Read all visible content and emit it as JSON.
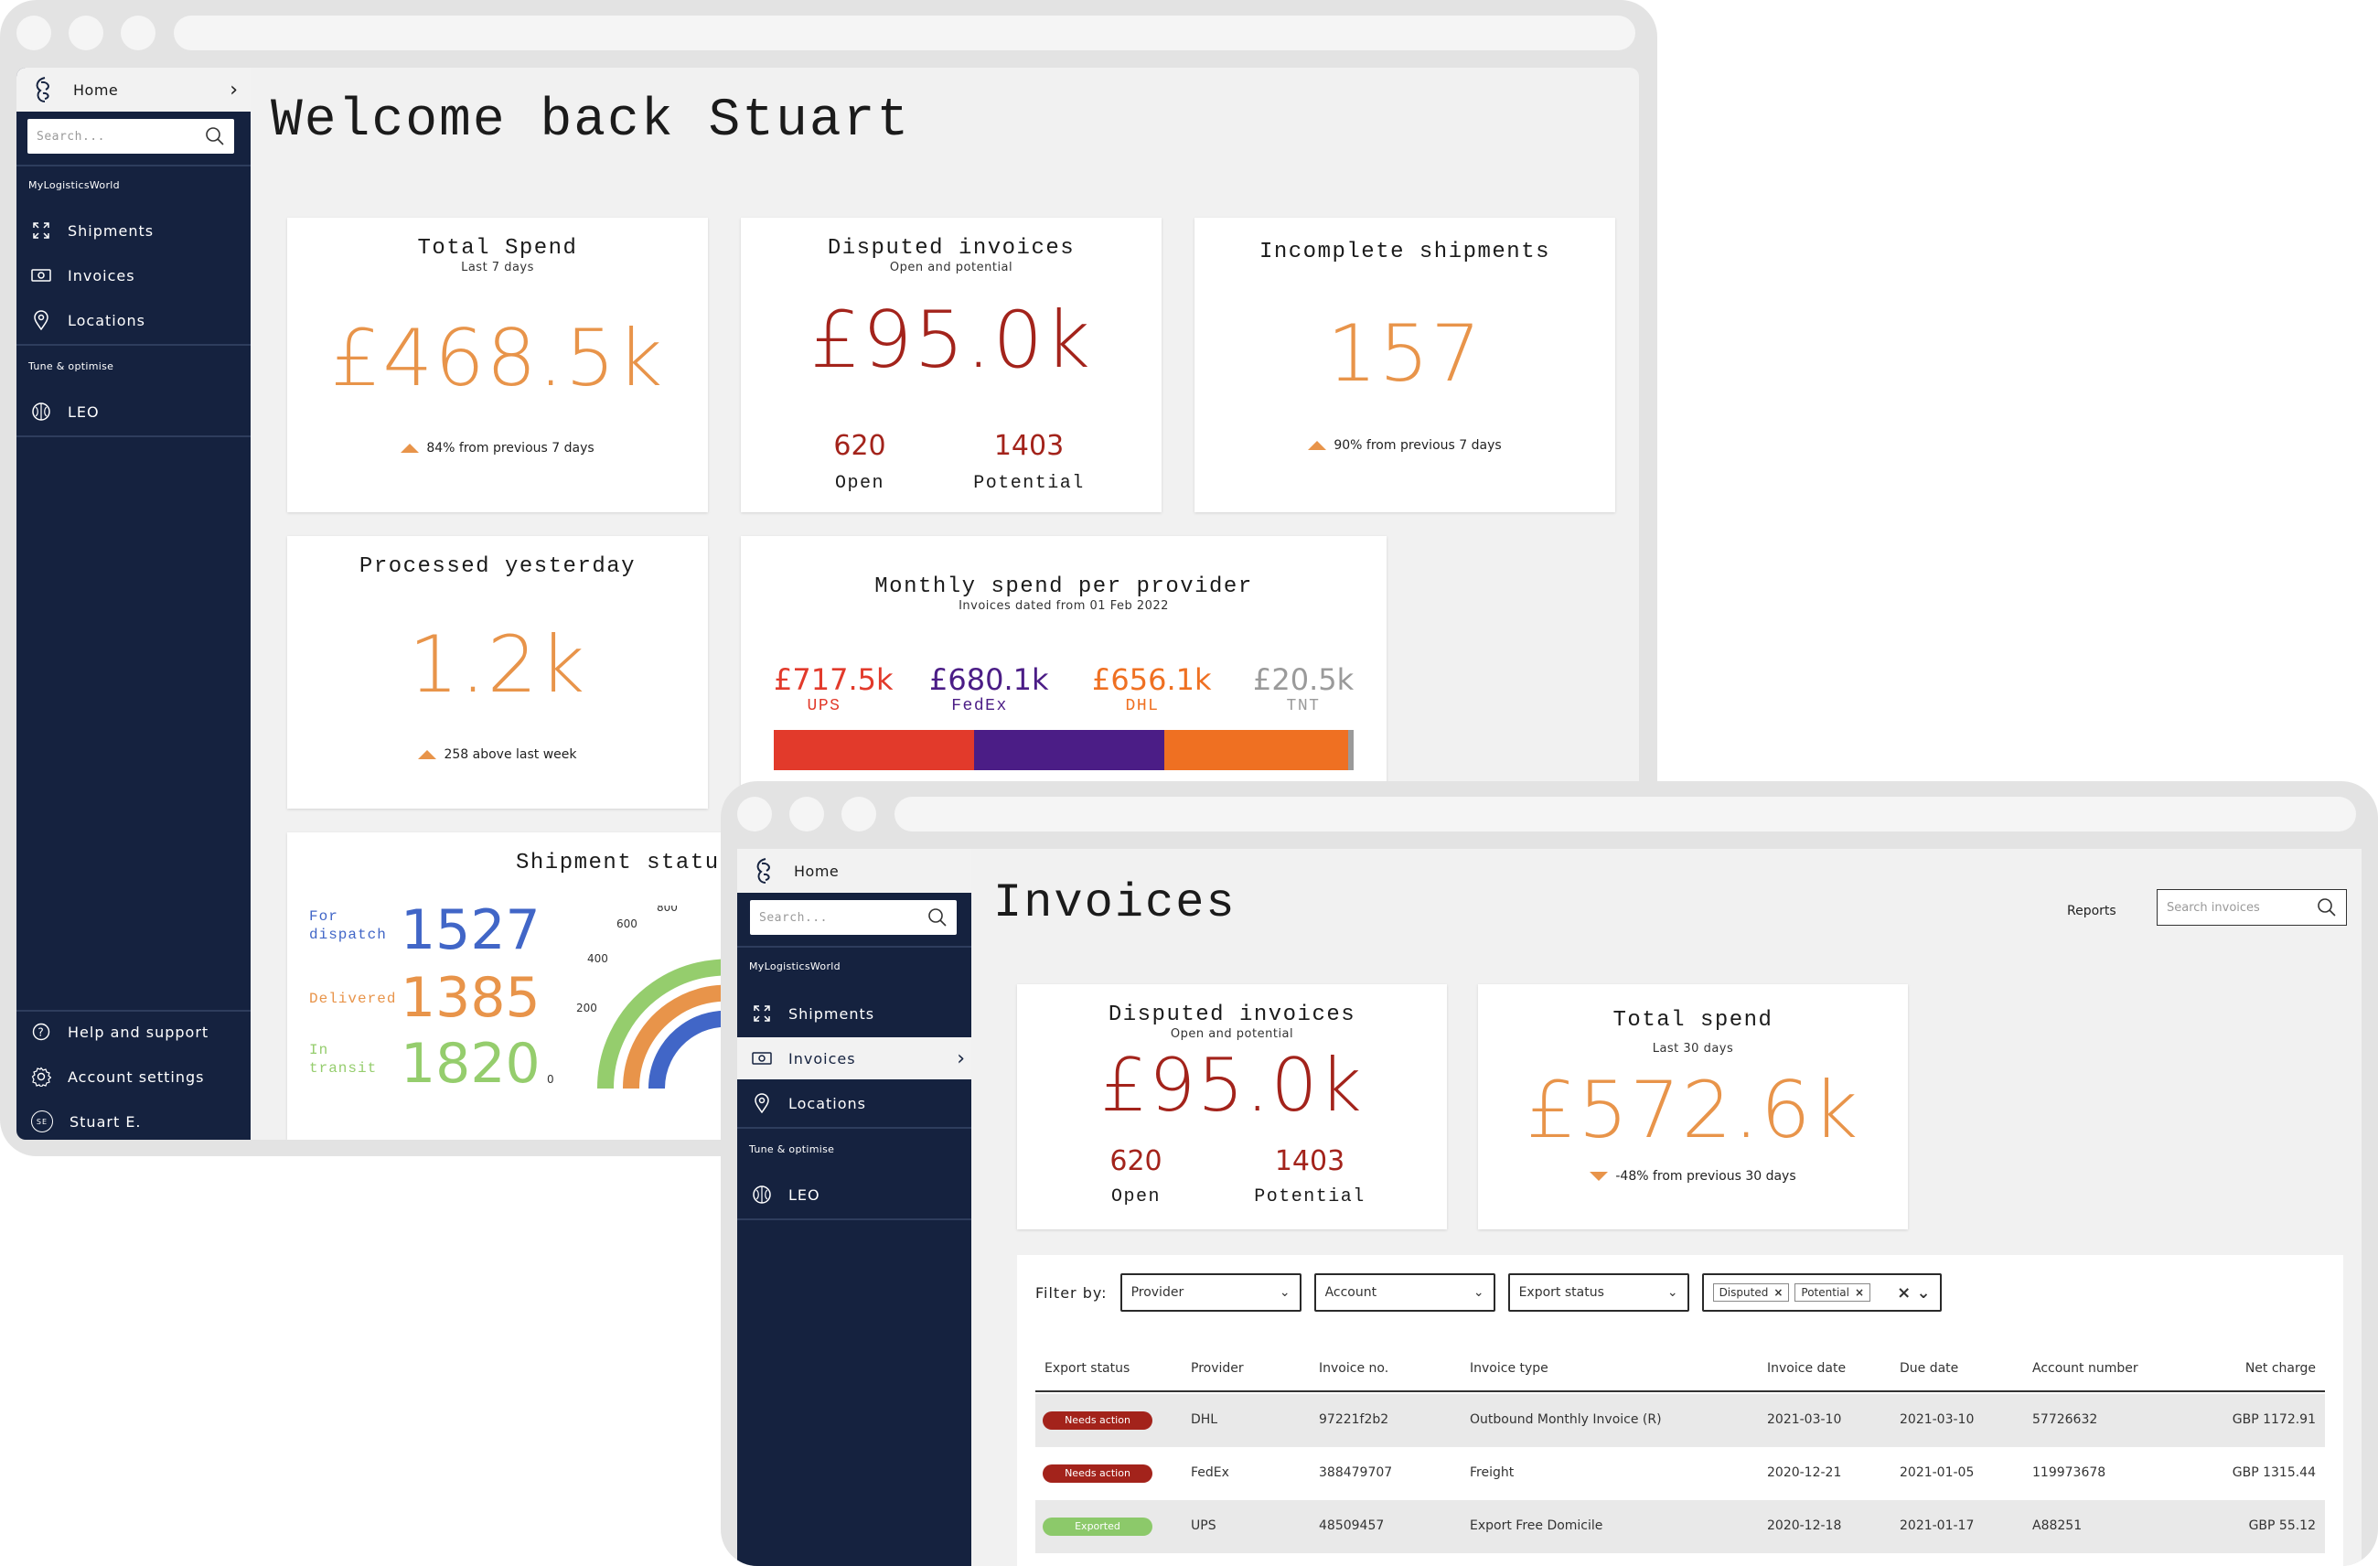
{
  "back_window": {
    "sidebar": {
      "home_label": "Home",
      "search_placeholder": "Search...",
      "section_main": "MyLogisticsWorld",
      "items": [
        {
          "label": "Shipments",
          "icon": "expand-arrows-icon"
        },
        {
          "label": "Invoices",
          "icon": "invoice-icon"
        },
        {
          "label": "Locations",
          "icon": "location-pin-icon"
        }
      ],
      "section_tune": "Tune & optimise",
      "leo_label": "LEO",
      "bottom_items": [
        {
          "label": "Help and support",
          "icon": "help-icon"
        },
        {
          "label": "Account settings",
          "icon": "gear-icon"
        },
        {
          "label": "Stuart E.",
          "icon": "avatar",
          "initials": "SE"
        }
      ]
    },
    "welcome": "Welcome back Stuart",
    "total_spend": {
      "title": "Total Spend",
      "subtitle": "Last 7 days",
      "value": "£468.5k",
      "delta": "84% from previous 7 days"
    },
    "disputed": {
      "title": "Disputed invoices",
      "subtitle": "Open and potential",
      "value": "£95.0k",
      "open_count": "620",
      "open_label": "Open",
      "potential_count": "1403",
      "potential_label": "Potential"
    },
    "incomplete": {
      "title": "Incomplete shipments",
      "value": "157",
      "delta": "90% from previous 7 days"
    },
    "processed": {
      "title": "Processed yesterday",
      "value": "1.2k",
      "delta": "258 above last week"
    },
    "monthly": {
      "title": "Monthly spend per provider",
      "subtitle": "Invoices dated from 01 Feb 2022",
      "providers": [
        {
          "value": "£717.5k",
          "name": "UPS",
          "color": "#e23a2b",
          "amount": 717.5
        },
        {
          "value": "£680.1k",
          "name": "FedEx",
          "color": "#4b1d86",
          "amount": 680.1
        },
        {
          "value": "£656.1k",
          "name": "DHL",
          "color": "#ef7022",
          "amount": 656.1
        },
        {
          "value": "£20.5k",
          "name": "TNT",
          "color": "#9a9a9a",
          "amount": 20.5
        }
      ]
    },
    "shipment_status": {
      "title": "Shipment status",
      "rows": [
        {
          "label": "For dispatch",
          "value": "1527",
          "color": "#4166c7"
        },
        {
          "label": "Delivered",
          "value": "1385",
          "color": "#e8944a"
        },
        {
          "label": "In transit",
          "value": "1820",
          "color": "#95cd6d"
        }
      ],
      "gauge_ticks": [
        "0",
        "200",
        "400",
        "600",
        "800"
      ]
    }
  },
  "front_window": {
    "sidebar": {
      "home_label": "Home",
      "search_placeholder": "Search...",
      "section_main": "MyLogisticsWorld",
      "items": [
        {
          "label": "Shipments",
          "icon": "expand-arrows-icon"
        },
        {
          "label": "Invoices",
          "icon": "invoice-icon",
          "active": true
        },
        {
          "label": "Locations",
          "icon": "location-pin-icon"
        }
      ],
      "section_tune": "Tune & optimise",
      "leo_label": "LEO"
    },
    "page_title": "Invoices",
    "reports_link": "Reports",
    "search_placeholder": "Search invoices",
    "disputed": {
      "title": "Disputed invoices",
      "subtitle": "Open and potential",
      "value": "£95.0k",
      "open_count": "620",
      "open_label": "Open",
      "potential_count": "1403",
      "potential_label": "Potential"
    },
    "total_spend": {
      "title": "Total spend",
      "subtitle": "Last 30 days",
      "value": "£572.6k",
      "delta": "-48% from previous 30 days"
    },
    "filters": {
      "label": "Filter by:",
      "provider": "Provider",
      "account": "Account",
      "export_status": "Export status",
      "chips": [
        "Disputed",
        "Potential"
      ]
    },
    "table": {
      "headers": [
        "Export status",
        "Provider",
        "Invoice no.",
        "Invoice type",
        "Invoice date",
        "Due date",
        "Account number",
        "Net charge"
      ],
      "rows": [
        {
          "status": "Needs action",
          "status_color": "#a3231b",
          "provider": "DHL",
          "invoice_no": "97221f2b2",
          "type": "Outbound Monthly Invoice (R)",
          "invoice_date": "2021-03-10",
          "due_date": "2021-03-10",
          "account": "57726632",
          "net": "GBP 1172.91"
        },
        {
          "status": "Needs action",
          "status_color": "#a3231b",
          "provider": "FedEx",
          "invoice_no": "388479707",
          "type": "Freight",
          "invoice_date": "2020-12-21",
          "due_date": "2021-01-05",
          "account": "119973678",
          "net": "GBP 1315.44"
        },
        {
          "status": "Exported",
          "status_color": "#8cc96a",
          "provider": "UPS",
          "invoice_no": "48509457",
          "type": "Export Free Domicile",
          "invoice_date": "2020-12-18",
          "due_date": "2021-01-17",
          "account": "A88251",
          "net": "GBP 55.12"
        }
      ]
    }
  }
}
